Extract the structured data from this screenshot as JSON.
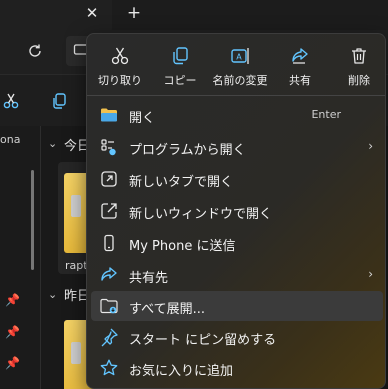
{
  "explorer": {
    "tab_close_glyph": "✕",
    "tab_new_glyph": "+",
    "sidebar_label": "ona",
    "groups": [
      {
        "label": "今日"
      },
      {
        "label": "昨日"
      }
    ],
    "file_name": "rapt"
  },
  "context_menu": {
    "quick_actions": [
      {
        "label": "切り取り",
        "icon": "cut-icon"
      },
      {
        "label": "コピー",
        "icon": "copy-icon"
      },
      {
        "label": "名前の変更",
        "icon": "rename-icon"
      },
      {
        "label": "共有",
        "icon": "share-icon"
      },
      {
        "label": "削除",
        "icon": "delete-icon"
      }
    ],
    "items": [
      {
        "label": "開く",
        "shortcut": "Enter",
        "icon": "folder-open-icon"
      },
      {
        "label": "プログラムから開く",
        "icon": "open-with-icon",
        "submenu": true
      },
      {
        "label": "新しいタブで開く",
        "icon": "new-tab-icon"
      },
      {
        "label": "新しいウィンドウで開く",
        "icon": "new-window-icon"
      },
      {
        "label": "My Phone に送信",
        "icon": "phone-icon"
      },
      {
        "label": "共有先",
        "icon": "share-to-icon",
        "submenu": true
      },
      {
        "label": "すべて展開...",
        "icon": "extract-all-icon",
        "hovered": true
      },
      {
        "label": "スタート にピン留めする",
        "icon": "pin-icon"
      },
      {
        "label": "お気に入りに追加",
        "icon": "star-icon"
      }
    ],
    "submenu_glyph": "›"
  },
  "colors": {
    "accent": "#60cdff",
    "folder": "#f2c14e"
  }
}
